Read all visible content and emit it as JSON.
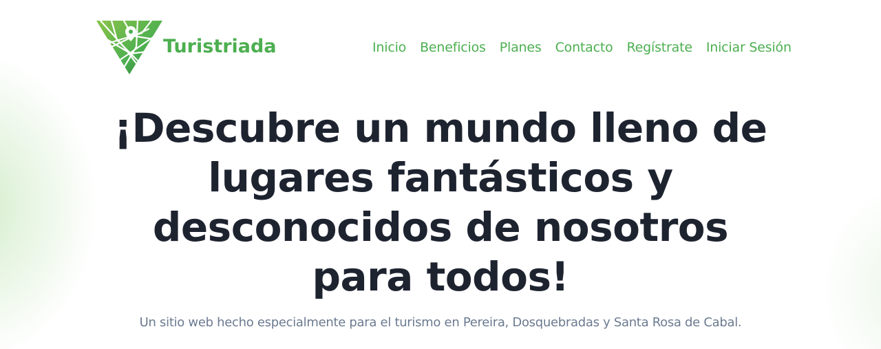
{
  "brand": {
    "name": "Turistriada",
    "color": "#4caf50"
  },
  "nav": {
    "items": [
      {
        "label": "Inicio"
      },
      {
        "label": "Beneficios"
      },
      {
        "label": "Planes"
      },
      {
        "label": "Contacto"
      },
      {
        "label": "Regístrate"
      },
      {
        "label": "Iniciar Sesión"
      }
    ]
  },
  "hero": {
    "title": "¡Descubre un mundo lleno de lugares fantásticos y desconocidos de nosotros para todos!",
    "subtitle": "Un sitio web hecho especialmente para el turismo en Pereira, Dosquebradas y Santa Rosa de Cabal."
  },
  "colors": {
    "accent": "#4caf50",
    "title": "#1e2330",
    "subtitle": "#6b7a90"
  },
  "icons": {
    "logo": "triangle-map-logo-icon"
  }
}
